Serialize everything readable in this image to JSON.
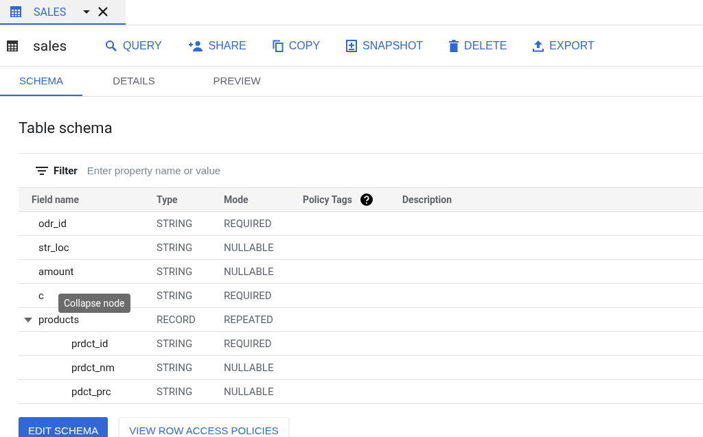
{
  "editor_tab": {
    "title": "SALES"
  },
  "header": {
    "title": "sales",
    "actions": [
      {
        "kind": "query",
        "label": "QUERY"
      },
      {
        "kind": "share",
        "label": "SHARE"
      },
      {
        "kind": "copy",
        "label": "COPY"
      },
      {
        "kind": "snapshot",
        "label": "SNAPSHOT"
      },
      {
        "kind": "delete",
        "label": "DELETE"
      },
      {
        "kind": "export",
        "label": "EXPORT"
      }
    ]
  },
  "tabs": [
    {
      "label": "SCHEMA",
      "selected": true
    },
    {
      "label": "DETAILS",
      "selected": false
    },
    {
      "label": "PREVIEW",
      "selected": false
    }
  ],
  "section_title": "Table schema",
  "filter": {
    "label": "Filter",
    "placeholder": "Enter property name or value"
  },
  "table": {
    "columns": [
      "Field name",
      "Type",
      "Mode",
      "Policy Tags",
      "Description"
    ],
    "rows": [
      {
        "name": "odr_id",
        "type": "STRING",
        "mode": "REQUIRED"
      },
      {
        "name": "str_loc",
        "type": "STRING",
        "mode": "NULLABLE"
      },
      {
        "name": "amount",
        "type": "STRING",
        "mode": "NULLABLE"
      },
      {
        "name": "c",
        "type": "STRING",
        "mode": "REQUIRED"
      },
      {
        "name": "products",
        "type": "RECORD",
        "mode": "REPEATED",
        "expanded": true,
        "children": [
          {
            "name": "prdct_id",
            "type": "STRING",
            "mode": "REQUIRED"
          },
          {
            "name": "prdct_nm",
            "type": "STRING",
            "mode": "NULLABLE"
          },
          {
            "name": "pdct_prc",
            "type": "STRING",
            "mode": "NULLABLE"
          }
        ]
      }
    ]
  },
  "tooltip": "Collapse node",
  "buttons": [
    {
      "kind": "primary",
      "label": "EDIT SCHEMA"
    },
    {
      "kind": "secondary",
      "label": "VIEW ROW ACCESS POLICIES"
    }
  ]
}
